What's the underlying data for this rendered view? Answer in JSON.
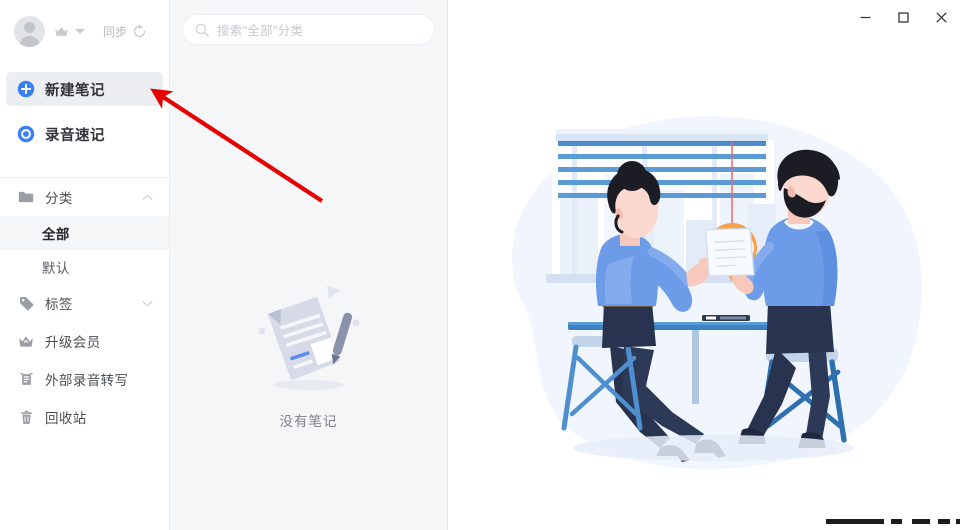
{
  "account": {
    "avatar_name": "user-avatar",
    "crown_icon": "crown-icon",
    "dropdown_icon": "chevron-down-icon",
    "sync_label": "同步",
    "sync_icon": "sync-refresh-icon"
  },
  "actions": [
    {
      "label": "新建笔记",
      "icon": "plus-circle-icon",
      "selected": true
    },
    {
      "label": "录音速记",
      "icon": "record-circle-icon",
      "selected": false
    }
  ],
  "nav": {
    "category": {
      "label": "分类",
      "icon": "folder-icon",
      "chevron": "chevron-up-icon"
    },
    "category_items": [
      {
        "label": "全部",
        "active": true
      },
      {
        "label": "默认",
        "active": false
      }
    ],
    "items": [
      {
        "label": "标签",
        "icon": "tag-icon",
        "chevron": "chevron-down-icon"
      },
      {
        "label": "升级会员",
        "icon": "crown-icon",
        "chevron": ""
      },
      {
        "label": "外部录音转写",
        "icon": "transcribe-doc-icon",
        "chevron": ""
      },
      {
        "label": "回收站",
        "icon": "trash-icon",
        "chevron": ""
      }
    ]
  },
  "search": {
    "placeholder": "搜索\"全部\"分类",
    "value": "",
    "icon": "search-icon"
  },
  "list": {
    "empty_text": "没有笔记",
    "empty_icon": "empty-note-document-icon"
  },
  "window": {
    "minimize_label": "—",
    "maximize_label": "□",
    "close_label": "✕"
  },
  "illustration": {
    "name": "two-people-meeting-recording-illustration",
    "mic_badge_icon": "microphone-wave-icon",
    "mic_badge_color": "#F5A04A",
    "blinds_color": "#5B9BD5",
    "shirt_color": "#6C9BE8",
    "pants_color": "#28344F"
  },
  "annotation": {
    "arrow_color": "#E60000",
    "arrow_name": "red-pointer-arrow",
    "points_to": "新建笔记"
  },
  "colors": {
    "accent_blue": "#3C7EF3",
    "sidebar_bg": "#FFFFFF",
    "list_bg": "#F5F6F8",
    "main_bg": "#FFFFFF",
    "selected_bg": "#ECEEF2"
  }
}
